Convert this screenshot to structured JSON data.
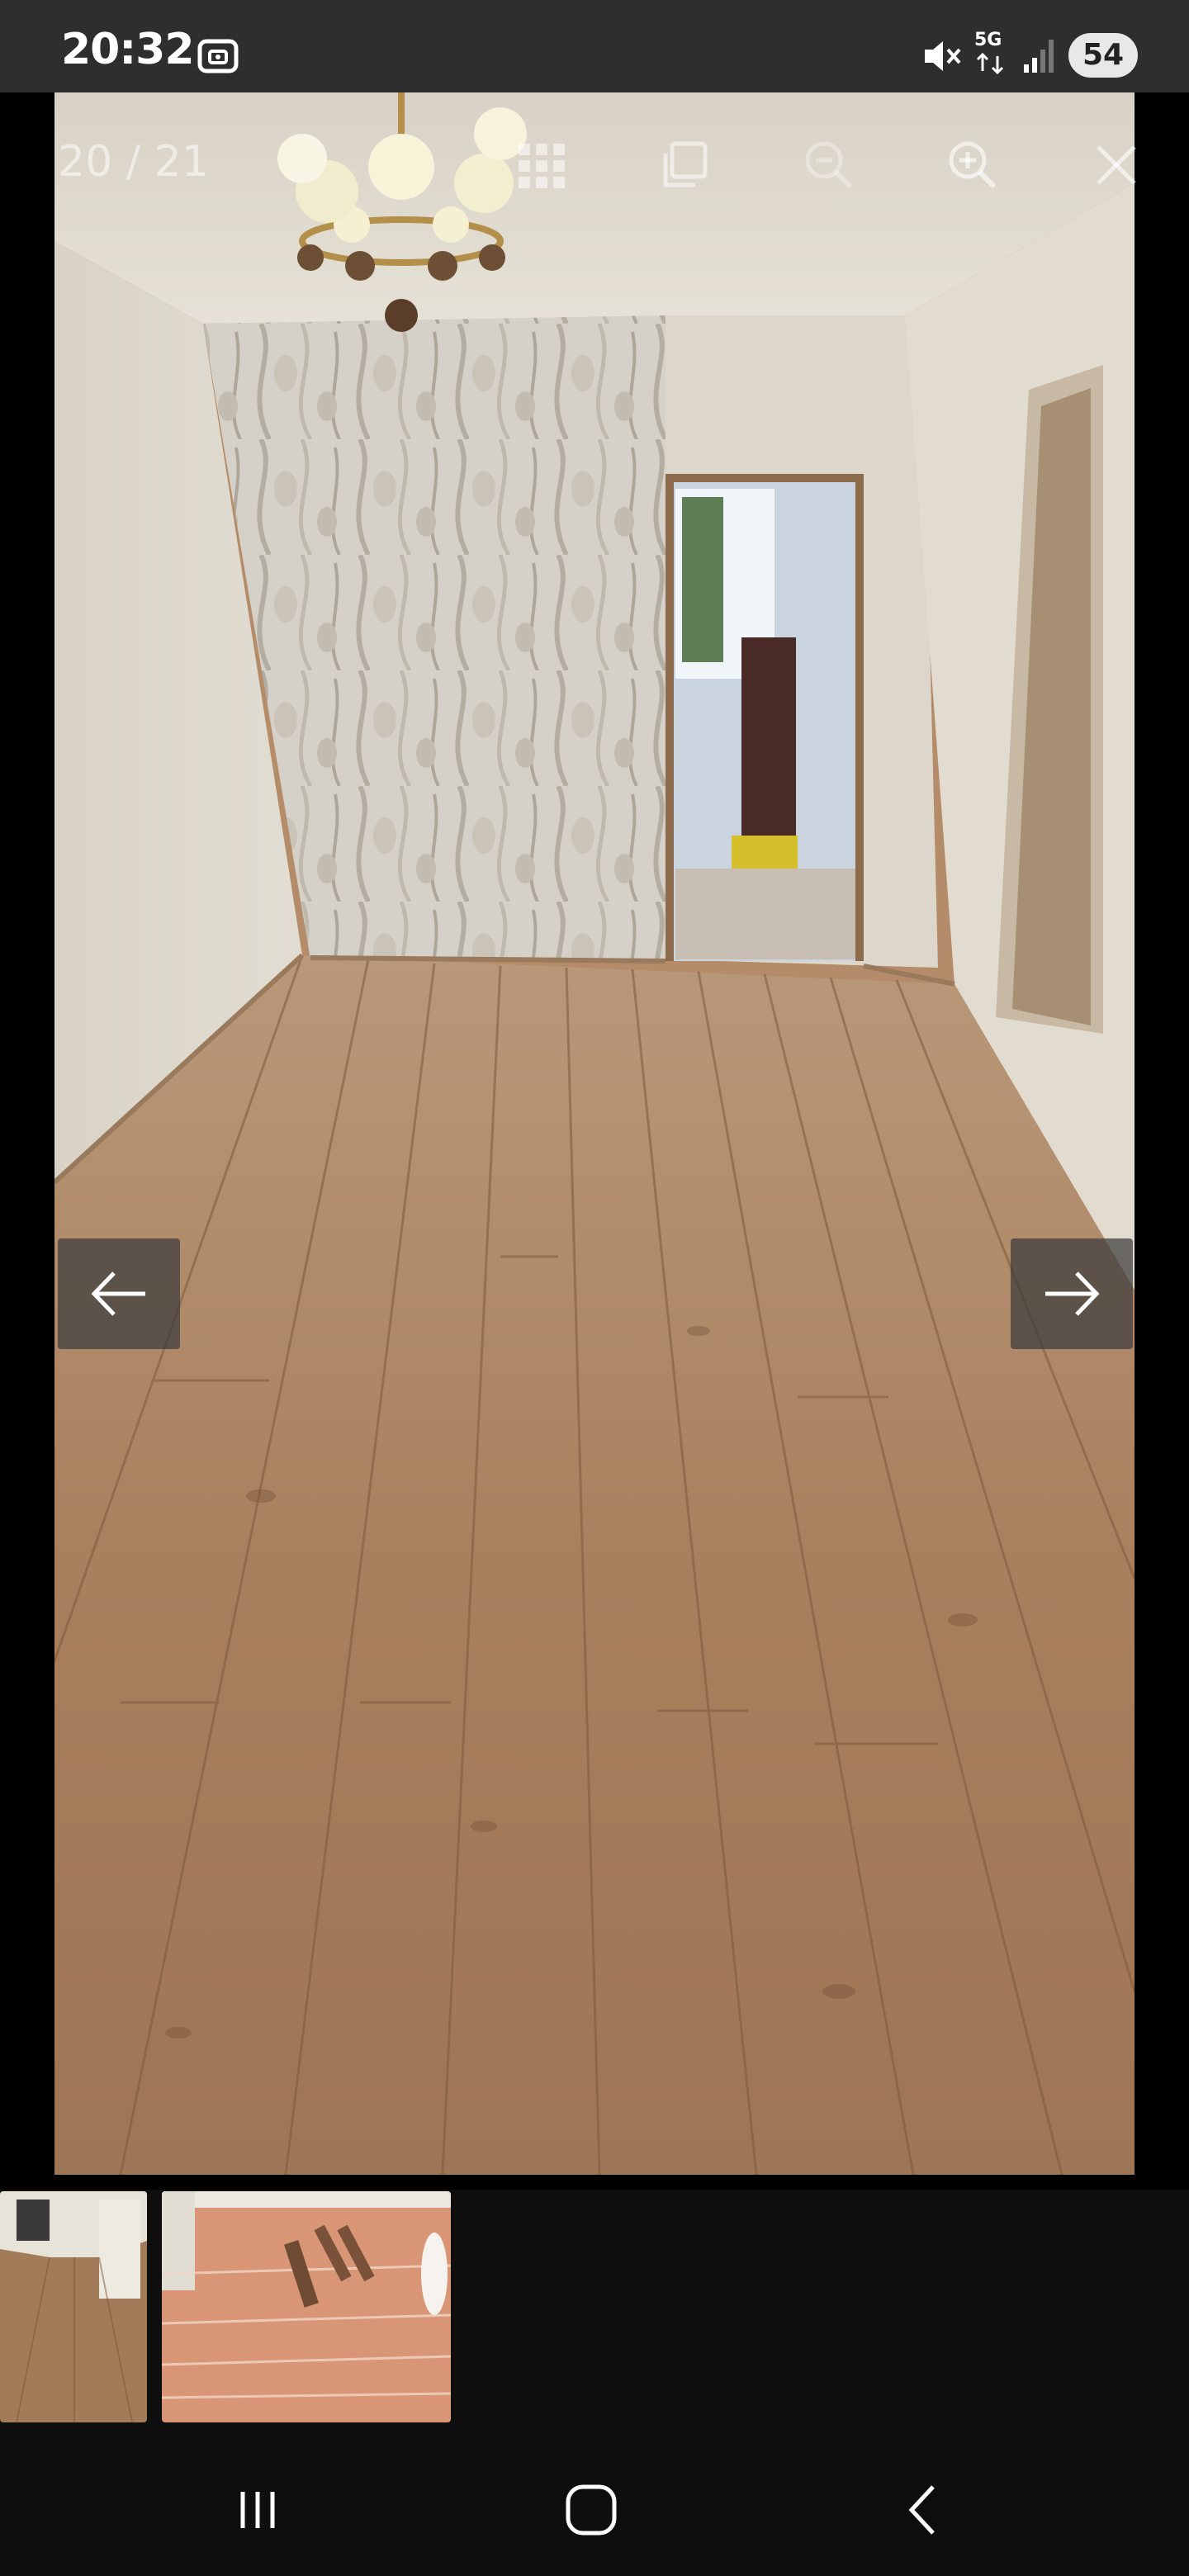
{
  "status_bar": {
    "time": "20:32",
    "network": "5G",
    "battery": "54",
    "icons": [
      "screenshot-icon",
      "mute-icon",
      "signal-icon"
    ]
  },
  "viewer": {
    "counter": "20 / 21",
    "toolbar": [
      "grid-icon",
      "copy-icon",
      "zoom-out-icon",
      "zoom-in-icon",
      "close-icon"
    ],
    "prev_icon": "arrow-left-icon",
    "next_icon": "arrow-right-icon"
  },
  "thumbnails": {
    "count_visible": 2
  },
  "nav_bar": {
    "buttons": [
      "recent-apps-icon",
      "home-icon",
      "back-icon"
    ]
  }
}
